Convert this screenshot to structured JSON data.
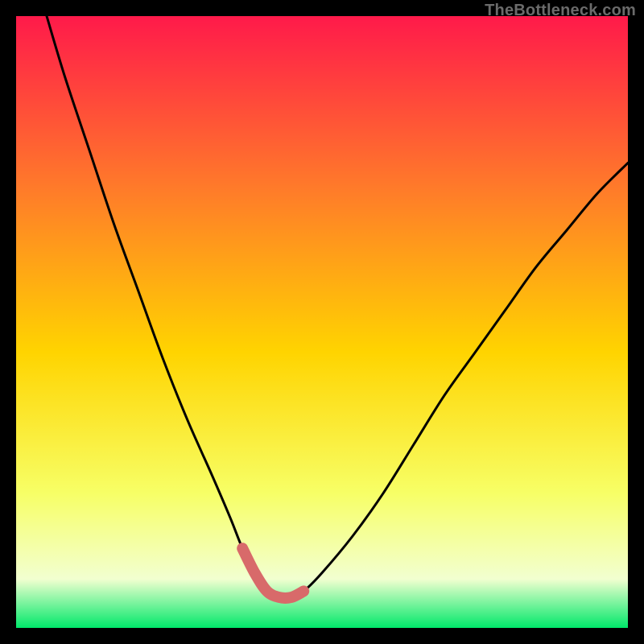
{
  "watermark": {
    "text": "TheBottleneck.com"
  },
  "colors": {
    "bg_black": "#000000",
    "grad_top": "#ff1a4a",
    "grad_mid_upper": "#ff7a2a",
    "grad_mid": "#ffd400",
    "grad_lower": "#f7ff66",
    "grad_pale": "#f2ffd0",
    "grad_green": "#00e86a",
    "curve_stroke": "#000000",
    "highlight_stroke": "#d86a6a"
  },
  "chart_data": {
    "type": "line",
    "title": "",
    "xlabel": "",
    "ylabel": "",
    "xlim": [
      0,
      100
    ],
    "ylim": [
      0,
      100
    ],
    "series": [
      {
        "name": "bottleneck-curve",
        "x": [
          5,
          8,
          12,
          16,
          20,
          24,
          28,
          32,
          35,
          37,
          39,
          41,
          43,
          45,
          47,
          50,
          55,
          60,
          65,
          70,
          75,
          80,
          85,
          90,
          95,
          100
        ],
        "y": [
          100,
          90,
          78,
          66,
          55,
          44,
          34,
          25,
          18,
          13,
          9,
          6,
          5,
          5,
          6,
          9,
          15,
          22,
          30,
          38,
          45,
          52,
          59,
          65,
          71,
          76
        ]
      },
      {
        "name": "optimal-range-highlight",
        "x": [
          37,
          39,
          41,
          43,
          45,
          47
        ],
        "y": [
          13,
          9,
          6,
          5,
          5,
          6
        ]
      }
    ],
    "annotations": []
  }
}
